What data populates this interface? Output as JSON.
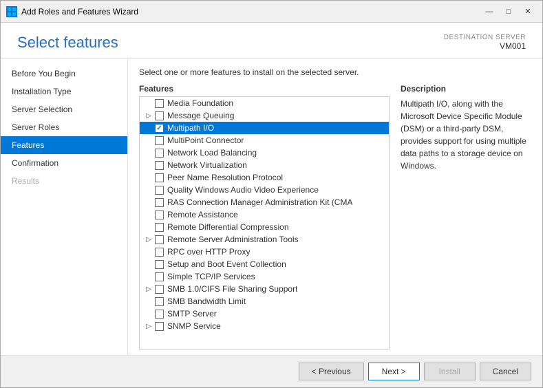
{
  "window": {
    "title": "Add Roles and Features Wizard",
    "controls": {
      "minimize": "—",
      "maximize": "□",
      "close": "✕"
    }
  },
  "header": {
    "page_title": "Select features",
    "destination_label": "DESTINATION SERVER",
    "server_name": "VM001"
  },
  "description_row": "Select one or more features to install on the selected server.",
  "sidebar": {
    "items": [
      {
        "label": "Before You Begin",
        "state": "normal"
      },
      {
        "label": "Installation Type",
        "state": "normal"
      },
      {
        "label": "Server Selection",
        "state": "normal"
      },
      {
        "label": "Server Roles",
        "state": "normal"
      },
      {
        "label": "Features",
        "state": "active"
      },
      {
        "label": "Confirmation",
        "state": "normal"
      },
      {
        "label": "Results",
        "state": "disabled"
      }
    ]
  },
  "features": {
    "header": "Features",
    "items": [
      {
        "label": "Media Foundation",
        "checked": false,
        "expandable": false,
        "indent": 0
      },
      {
        "label": "Message Queuing",
        "checked": false,
        "expandable": true,
        "indent": 0
      },
      {
        "label": "Multipath I/O",
        "checked": true,
        "expandable": false,
        "indent": 0,
        "highlighted": true
      },
      {
        "label": "MultiPoint Connector",
        "checked": false,
        "expandable": false,
        "indent": 0
      },
      {
        "label": "Network Load Balancing",
        "checked": false,
        "expandable": false,
        "indent": 0
      },
      {
        "label": "Network Virtualization",
        "checked": false,
        "expandable": false,
        "indent": 0
      },
      {
        "label": "Peer Name Resolution Protocol",
        "checked": false,
        "expandable": false,
        "indent": 0
      },
      {
        "label": "Quality Windows Audio Video Experience",
        "checked": false,
        "expandable": false,
        "indent": 0
      },
      {
        "label": "RAS Connection Manager Administration Kit (CMA",
        "checked": false,
        "expandable": false,
        "indent": 0
      },
      {
        "label": "Remote Assistance",
        "checked": false,
        "expandable": false,
        "indent": 0
      },
      {
        "label": "Remote Differential Compression",
        "checked": false,
        "expandable": false,
        "indent": 0
      },
      {
        "label": "Remote Server Administration Tools",
        "checked": false,
        "expandable": true,
        "indent": 0
      },
      {
        "label": "RPC over HTTP Proxy",
        "checked": false,
        "expandable": false,
        "indent": 0
      },
      {
        "label": "Setup and Boot Event Collection",
        "checked": false,
        "expandable": false,
        "indent": 0
      },
      {
        "label": "Simple TCP/IP Services",
        "checked": false,
        "expandable": false,
        "indent": 0
      },
      {
        "label": "SMB 1.0/CIFS File Sharing Support",
        "checked": false,
        "expandable": true,
        "indent": 0
      },
      {
        "label": "SMB Bandwidth Limit",
        "checked": false,
        "expandable": false,
        "indent": 0
      },
      {
        "label": "SMTP Server",
        "checked": false,
        "expandable": false,
        "indent": 0
      },
      {
        "label": "SNMP Service",
        "checked": false,
        "expandable": true,
        "indent": 0
      }
    ]
  },
  "description": {
    "header": "Description",
    "text": "Multipath I/O, along with the Microsoft Device Specific Module (DSM) or a third-party DSM, provides support for using multiple data paths to a storage device on Windows."
  },
  "footer": {
    "previous_label": "< Previous",
    "next_label": "Next >",
    "install_label": "Install",
    "cancel_label": "Cancel"
  }
}
